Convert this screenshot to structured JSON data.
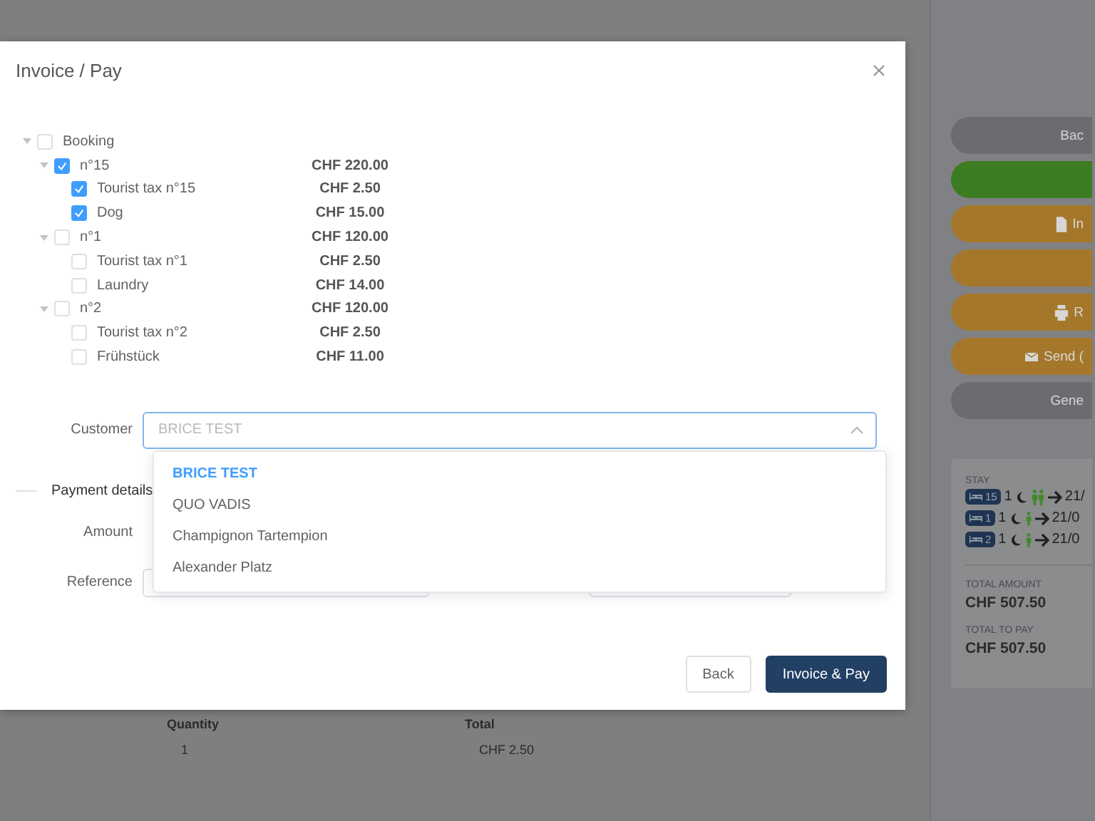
{
  "dialog": {
    "title": "Invoice / Pay",
    "tree": [
      {
        "label": "Booking",
        "checked": false,
        "expanded": true,
        "children": [
          {
            "label": "n°15",
            "amount": "CHF 220.00",
            "checked": true,
            "expanded": true,
            "children": [
              {
                "label": "Tourist tax n°15",
                "amount": "CHF 2.50",
                "checked": true
              },
              {
                "label": "Dog",
                "amount": "CHF 15.00",
                "checked": true
              }
            ]
          },
          {
            "label": "n°1",
            "amount": "CHF 120.00",
            "checked": false,
            "expanded": true,
            "children": [
              {
                "label": "Tourist tax n°1",
                "amount": "CHF 2.50",
                "checked": false
              },
              {
                "label": "Laundry",
                "amount": "CHF 14.00",
                "checked": false
              }
            ]
          },
          {
            "label": "n°2",
            "amount": "CHF 120.00",
            "checked": false,
            "expanded": true,
            "children": [
              {
                "label": "Tourist tax n°2",
                "amount": "CHF 2.50",
                "checked": false
              },
              {
                "label": "Frühstück",
                "amount": "CHF 11.00",
                "checked": false
              }
            ]
          }
        ]
      }
    ],
    "customer": {
      "label": "Customer",
      "placeholder": "BRICE TEST",
      "expanded": true,
      "options": [
        {
          "label": "BRICE TEST",
          "selected": true
        },
        {
          "label": "QUO VADIS",
          "selected": false
        },
        {
          "label": "Champignon Tartempion",
          "selected": false
        },
        {
          "label": "Alexander Platz",
          "selected": false
        }
      ]
    },
    "payment": {
      "heading": "Payment details",
      "amount_label": "Amount",
      "reference_label": "Reference"
    },
    "buttons": [
      {
        "label": "Back",
        "kind": "secondary"
      },
      {
        "label": "Invoice & Pay",
        "kind": "primary"
      }
    ]
  },
  "background": {
    "sidebar": {
      "buttons": [
        {
          "label": "Bac",
          "kind": "plain",
          "color": "#6a6c70"
        },
        {
          "kind": "plain",
          "color": "#3c7c22"
        },
        {
          "label": "In",
          "kind": "document",
          "color": "#a5772a"
        },
        {
          "kind": "plain",
          "color": "#a5772a"
        },
        {
          "label": "R",
          "kind": "print",
          "color": "#a5772a"
        },
        {
          "label": "Send (",
          "kind": "mail",
          "color": "#a5772a"
        },
        {
          "label": "Gene",
          "kind": "plain",
          "color": "#6a6c70"
        }
      ],
      "stay": {
        "heading": "STAY",
        "rows": [
          {
            "room": "15",
            "nights": "1",
            "kind": "couple",
            "date": "21/"
          },
          {
            "room": "1",
            "nights": "1",
            "kind": "single",
            "date": "21/0"
          },
          {
            "room": "2",
            "nights": "1",
            "kind": "single",
            "date": "21/0"
          }
        ]
      },
      "totals": [
        {
          "label": "TOTAL AMOUNT",
          "value": "CHF 507.50"
        },
        {
          "label": "TOTAL TO PAY",
          "value": "CHF 507.50"
        }
      ]
    },
    "table": {
      "columns": [
        "Quantity",
        "Total"
      ],
      "rows": [
        [
          "1",
          "CHF 2.50"
        ]
      ]
    }
  }
}
